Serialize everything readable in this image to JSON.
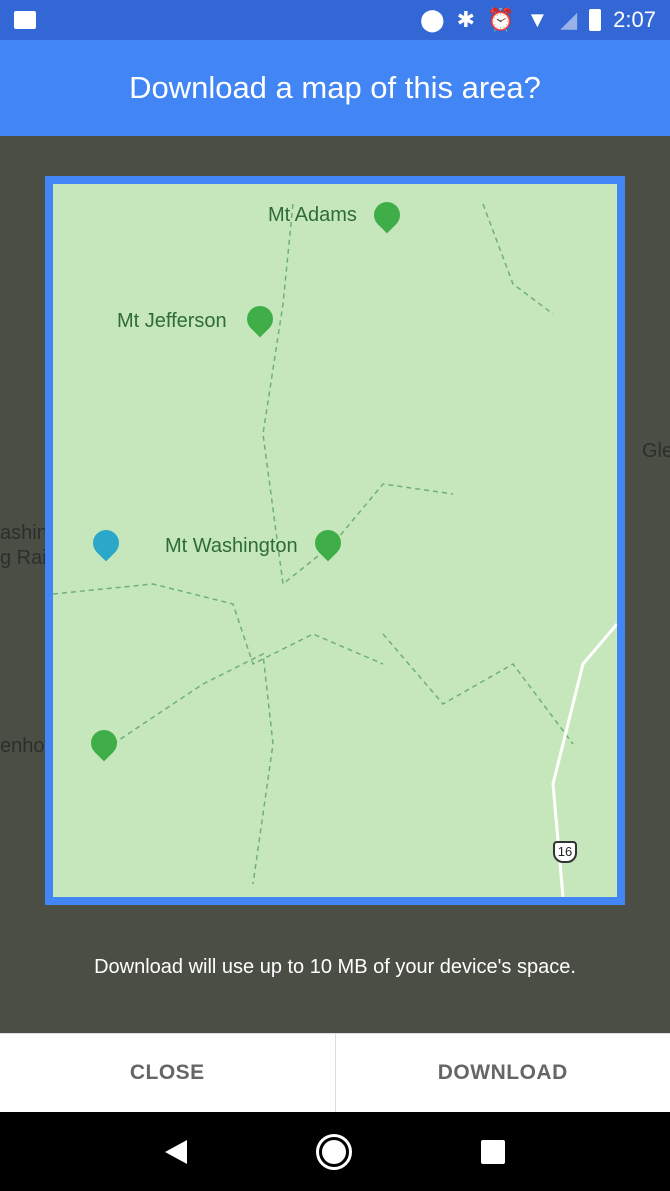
{
  "status_bar": {
    "time": "2:07",
    "icons": [
      "image-icon",
      "location-icon",
      "bluetooth-icon",
      "alarm-icon",
      "wifi-icon",
      "signal-icon",
      "battery-charging-icon"
    ]
  },
  "header": {
    "title": "Download a map of this area?"
  },
  "map": {
    "peaks": [
      "Mt Adams",
      "Mt Jefferson",
      "Mt Washington"
    ],
    "outside_labels": {
      "right": "Gle",
      "railway_line1": "ashington",
      "railway_line2": "g Railway",
      "eisenhower": "enhower"
    },
    "route_shield": "16"
  },
  "message": "Download will use up to 10 MB of your device's space.",
  "buttons": {
    "close": "CLOSE",
    "download": "DOWNLOAD"
  },
  "colors": {
    "accent": "#4285f4",
    "status": "#3367d6",
    "map_green": "#c6e7bb"
  }
}
